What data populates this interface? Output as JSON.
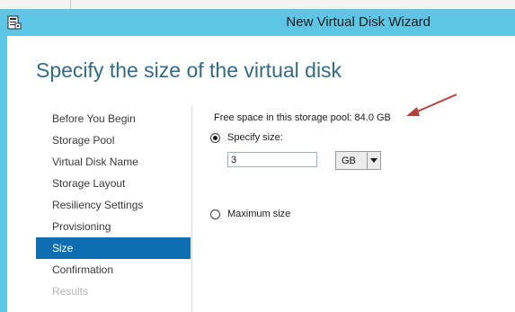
{
  "window": {
    "title": "New Virtual Disk Wizard"
  },
  "page": {
    "heading": "Specify the size of the virtual disk"
  },
  "nav": {
    "items": [
      {
        "label": "Before You Begin"
      },
      {
        "label": "Storage Pool"
      },
      {
        "label": "Virtual Disk Name"
      },
      {
        "label": "Storage Layout"
      },
      {
        "label": "Resiliency Settings"
      },
      {
        "label": "Provisioning"
      },
      {
        "label": "Size"
      },
      {
        "label": "Confirmation"
      },
      {
        "label": "Results"
      }
    ],
    "active_item": "Size",
    "disabled_item": "Results"
  },
  "size": {
    "free_space_text": "Free space in this storage pool: 84.0 GB",
    "specify_label": "Specify size:",
    "specify_selected": true,
    "size_value": "3",
    "unit_value": "GB",
    "maximum_label": "Maximum size",
    "maximum_selected": false
  },
  "annotation": {
    "arrow_color": "#b5413b"
  },
  "colors": {
    "frame": "#5cc6e4",
    "heading": "#2f6b8a",
    "nav_active_bg": "#0f6eb1"
  }
}
